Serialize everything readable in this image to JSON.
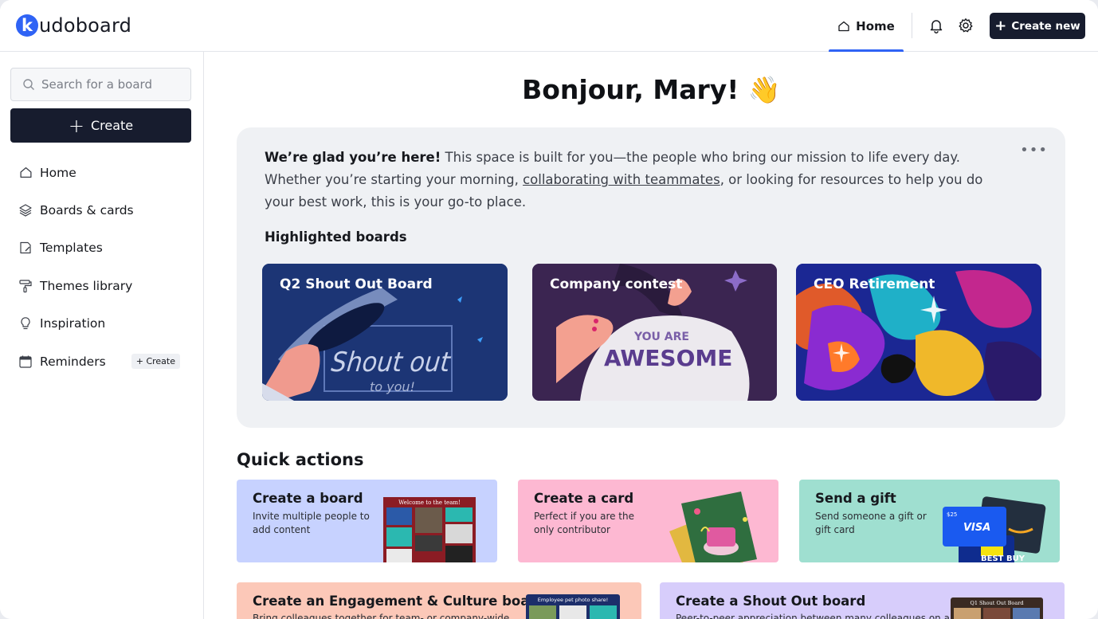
{
  "app": {
    "logo_letter": "k",
    "logo_rest": "udoboard"
  },
  "topnav": {
    "home_label": "Home",
    "bell_icon": "bell-icon",
    "settings_icon": "gear-icon",
    "create_new_label": "Create new"
  },
  "sidebar": {
    "search_placeholder": "Search for a board",
    "create_label": "Create",
    "items": [
      {
        "label": "Home",
        "icon": "house-icon"
      },
      {
        "label": "Boards & cards",
        "icon": "layers-icon"
      },
      {
        "label": "Templates",
        "icon": "template-icon"
      },
      {
        "label": "Themes library",
        "icon": "paint-roller-icon"
      },
      {
        "label": "Inspiration",
        "icon": "lightbulb-icon"
      },
      {
        "label": "Reminders",
        "icon": "calendar-icon"
      }
    ],
    "reminders_create": "+ Create"
  },
  "main": {
    "greeting": "Bonjour, Mary! 👋",
    "welcome": {
      "bold": "We’re glad you’re here!",
      "text1": " This space is built for you—the people who bring our mission to life every day. Whether you’re starting your morning, ",
      "link": "collaborating with teammates",
      "text2": ", or looking for resources to help you do your best work, this is your go-to place.",
      "more": "•••"
    },
    "highlighted_title": "Highlighted boards",
    "boards": [
      {
        "title": "Q2 Shout Out Board",
        "art_main": "Shout out",
        "art_sub": "to you!"
      },
      {
        "title": "Company contest",
        "art_main": "AWESOME",
        "art_sub": "YOU ARE"
      },
      {
        "title": "CEO Retirement"
      }
    ],
    "quick_actions_title": "Quick actions",
    "quick_actions": [
      {
        "title": "Create a board",
        "desc": "Invite multiple people to add content",
        "art_caption": "Welcome to the team!",
        "color": "#c7d2ff"
      },
      {
        "title": "Create a card",
        "desc": "Perfect if you are the only contributor",
        "color": "#fdb8d2"
      },
      {
        "title": "Send a gift",
        "desc": "Send someone a gift or gift card",
        "color": "#9fdfd0",
        "gift_visa": "VISA",
        "gift_amount": "$25",
        "gift_brand": "BEST BUY"
      },
      {
        "title": "Create an Engagement & Culture board",
        "desc": "Bring colleagues together for team- or company-wide",
        "art_caption": "Employee pet photo share!",
        "color": "#fcc8b8"
      },
      {
        "title": "Create a Shout Out board",
        "desc": "Peer-to-peer appreciation between many colleagues on a",
        "art_caption": "Q1 Shout Out Board",
        "color": "#d7cdfb"
      }
    ]
  }
}
